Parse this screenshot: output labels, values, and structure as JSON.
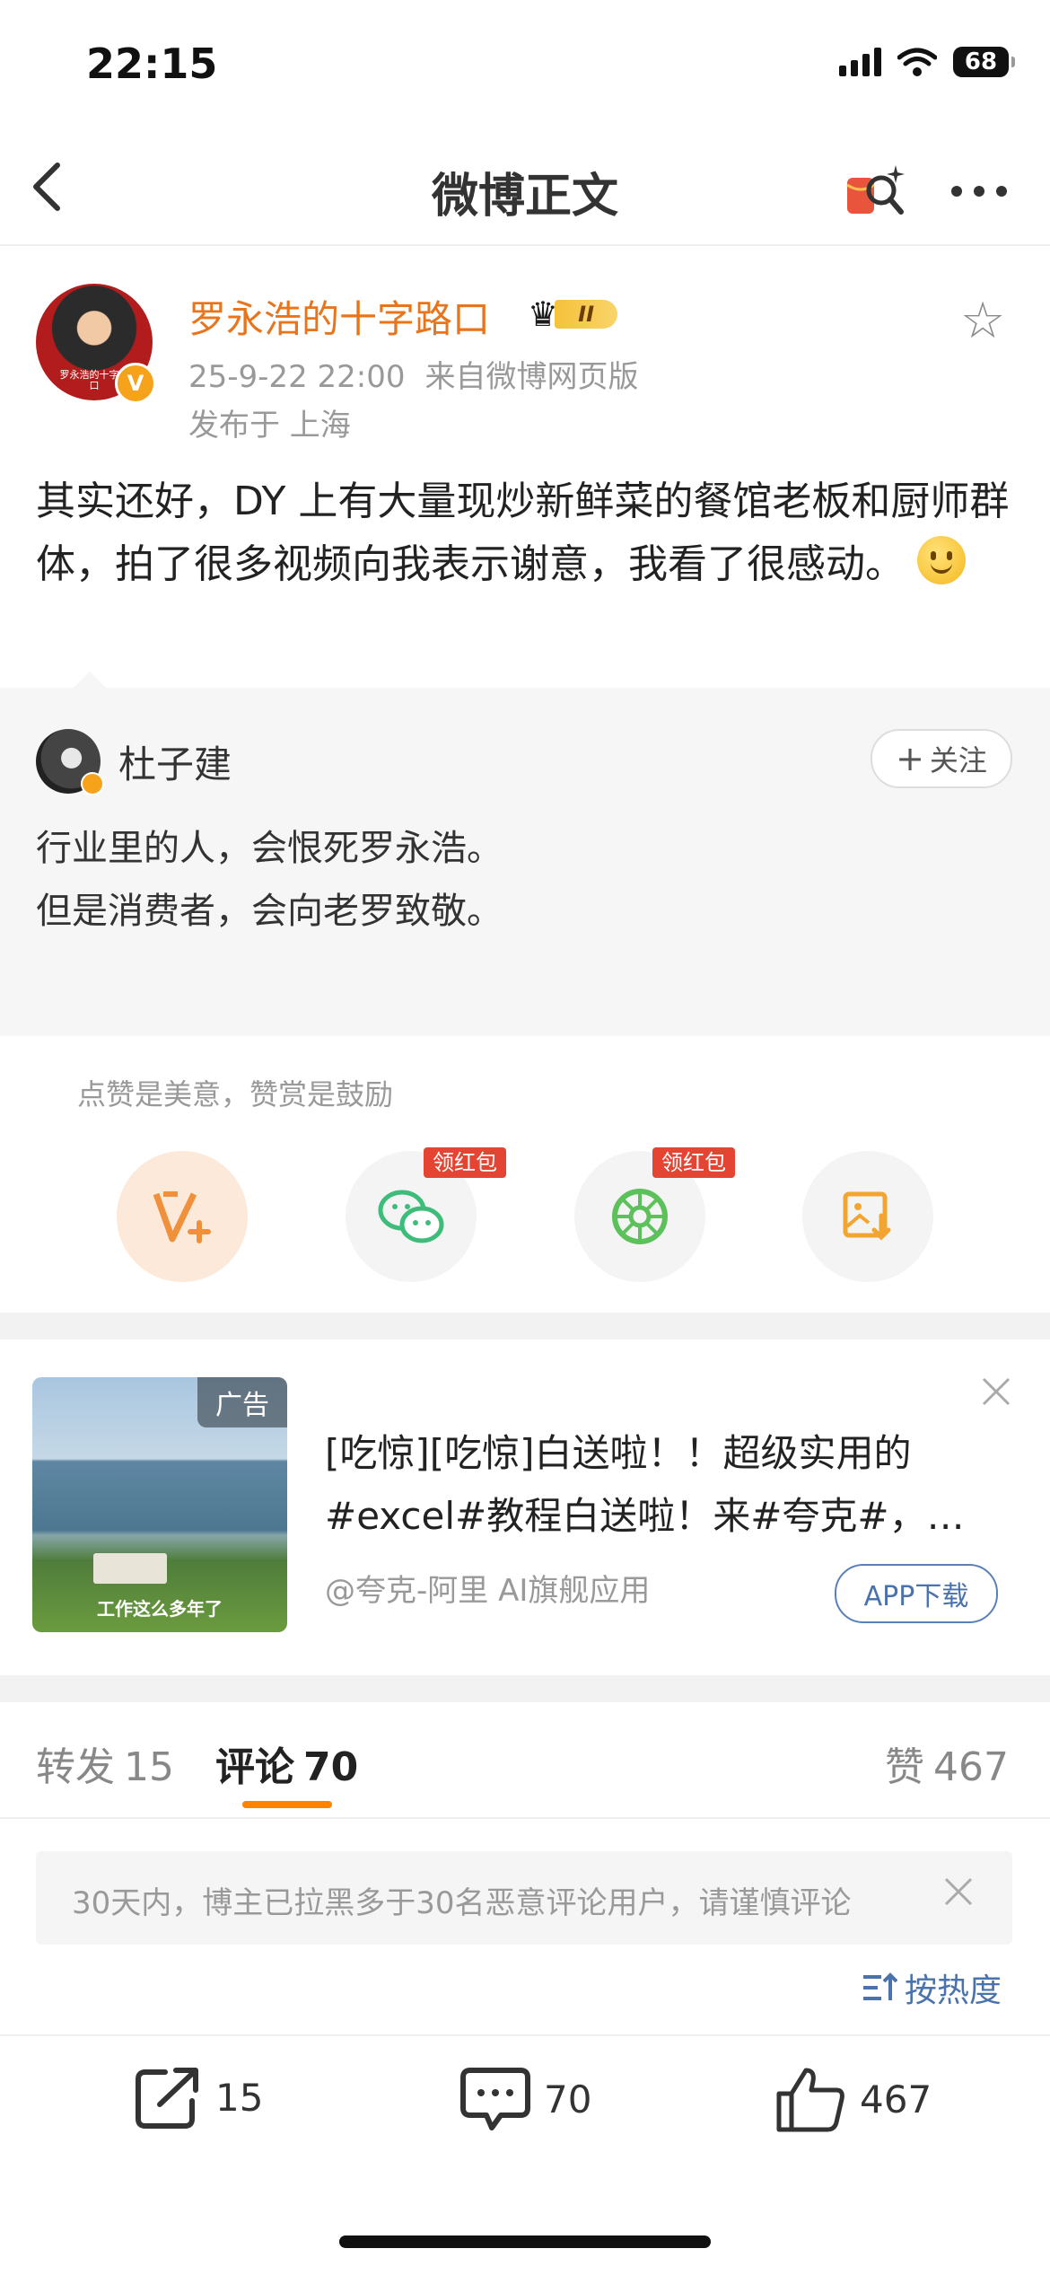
{
  "status_bar": {
    "time": "22:15",
    "battery": "68"
  },
  "header": {
    "title": "微博正文"
  },
  "post": {
    "username": "罗永浩的十字路口",
    "level": "II",
    "avatar_caption": "罗永浩的十字路口",
    "date": "25-9-22 22:00",
    "source": "来自微博网页版",
    "location": "发布于 上海",
    "text": "其实还好，DY 上有大量现炒新鲜菜的餐馆老板和厨师群体，拍了很多视频向我表示谢意，我看了很感动。"
  },
  "quote": {
    "username": "杜子建",
    "follow_label": "关注",
    "lines": [
      "行业里的人，会恨死罗永浩。",
      "但是消费者，会向老罗致敬。"
    ]
  },
  "reward": {
    "hint": "点赞是美意，赞赏是鼓励",
    "redpack_label": "领红包"
  },
  "ad": {
    "tag": "广告",
    "image_caption": "工作这么多年了",
    "text": "[吃惊][吃惊]白送啦！！超级实用的#excel#教程白送啦！来#夸克#，…",
    "source": "@夸克-阿里 AI旗舰应用",
    "button": "APP下载"
  },
  "tabs": [
    {
      "label": "转发",
      "count": "15"
    },
    {
      "label": "评论",
      "count": "70"
    },
    {
      "label": "赞",
      "count": "467"
    }
  ],
  "notice": {
    "text": "30天内，博主已拉黑多于30名恶意评论用户，请谨慎评论"
  },
  "sort": {
    "label": "按热度"
  },
  "actions": {
    "repost": "15",
    "comment": "70",
    "like": "467"
  },
  "colors": {
    "accent": "#ff8200",
    "username": "#e8741c",
    "link": "#4a72ad",
    "redpack": "#e34532"
  }
}
